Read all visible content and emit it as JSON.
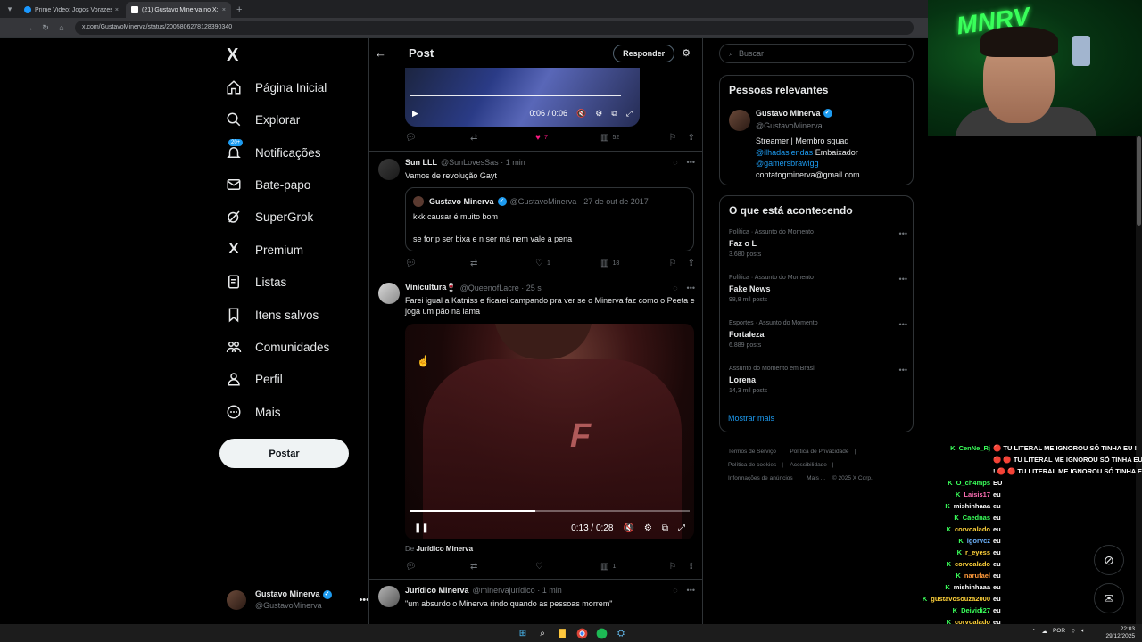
{
  "browser": {
    "tabs": [
      {
        "title": "Prime Video: Jogos Vorazes: A ...",
        "active": false,
        "favicon_color": "#1a98ff"
      },
      {
        "title": "(21) Gustavo Minerva no X: \"...",
        "active": true,
        "favicon_color": "#ffffff"
      }
    ],
    "new_tab": "+",
    "url": "x.com/GustavoMinerva/status/2005806278128390340"
  },
  "nav": {
    "logo": "X",
    "items": [
      {
        "label": "Página Inicial",
        "icon": "home-icon"
      },
      {
        "label": "Explorar",
        "icon": "search-icon"
      },
      {
        "label": "Notificações",
        "icon": "bell-icon",
        "badge": "20+"
      },
      {
        "label": "Bate-papo",
        "icon": "mail-icon"
      },
      {
        "label": "SuperGrok",
        "icon": "grok-icon"
      },
      {
        "label": "Premium",
        "icon": "x-icon"
      },
      {
        "label": "Listas",
        "icon": "list-icon"
      },
      {
        "label": "Itens salvos",
        "icon": "bookmark-icon"
      },
      {
        "label": "Comunidades",
        "icon": "communities-icon"
      },
      {
        "label": "Perfil",
        "icon": "person-icon"
      },
      {
        "label": "Mais",
        "icon": "more-circle-icon"
      }
    ],
    "post_button": "Postar",
    "account": {
      "name": "Gustavo Minerva",
      "handle": "@GustavoMinerva"
    }
  },
  "center": {
    "title": "Post",
    "reply_button": "Responder",
    "video1": {
      "time": "0:06 / 0:06",
      "progress": 1.0
    },
    "video1_actions": {
      "replies": "",
      "reposts": "",
      "likes": "7",
      "views": "52"
    },
    "tweets": [
      {
        "name": "Sun LLL",
        "handle": "@SunLovesSas",
        "time": "· 1 min",
        "text": "Vamos de revolução Gayt",
        "quote": {
          "name": "Gustavo Minerva",
          "handle": "@GustavoMinerva",
          "date": "· 27 de out de 2017",
          "line1": "kkk causar é muito bom",
          "line2": "se for p ser bixa e n ser má nem vale a pena"
        },
        "actions": {
          "replies": "",
          "reposts": "",
          "likes": "1",
          "views": "18"
        }
      },
      {
        "name": "Vinicultura🍷",
        "handle": "@QueenofLacre",
        "time": "· 25 s",
        "text": "Farei igual a Katniss e ficarei campando pra ver se o Minerva faz como o Peeta e joga um pão na lama",
        "video": {
          "time": "0:13 / 0:28",
          "progress": 0.45
        },
        "from_prefix": "De",
        "from_name": "Jurídico Minerva",
        "actions": {
          "replies": "",
          "reposts": "",
          "likes": "",
          "views": "1"
        }
      },
      {
        "name": "Jurídico Minerva",
        "handle": "@minervajurídico",
        "time": "· 1 min",
        "text": "\"um absurdo o Minerva rindo quando as pessoas morrem\""
      }
    ]
  },
  "right": {
    "search_placeholder": "Buscar",
    "relevant": {
      "title": "Pessoas relevantes",
      "name": "Gustavo Minerva",
      "handle": "@GustavoMinerva",
      "bio1": "Streamer | Membro squad",
      "bio_link1": "@ilhadaslendas",
      "bio2": " Embaixador",
      "bio_link2": "@gamersbrawlgg",
      "bio3": "contatogminerva@gmail.com"
    },
    "trends_title": "O que está acontecendo",
    "trends": [
      {
        "category": "Política · Assunto do Momento",
        "name": "Faz o L",
        "count": "3.680 posts"
      },
      {
        "category": "Política · Assunto do Momento",
        "name": "Fake News",
        "count": "98,8 mil posts"
      },
      {
        "category": "Esportes · Assunto do Momento",
        "name": "Fortaleza",
        "count": "6.889 posts"
      },
      {
        "category": "Assunto do Momento em Brasil",
        "name": "Lorena",
        "count": "14,3 mil posts"
      }
    ],
    "show_more": "Mostrar mais",
    "footer": [
      "Termos de Serviço",
      "|",
      "Política de Privacidade",
      "|",
      "Política de cookies",
      "|",
      "Acessibilidade",
      "|",
      "Informações de anúncios",
      "|",
      "Mais ...",
      "© 2025 X Corp."
    ]
  },
  "chat": [
    {
      "user": "CenNe_Rj",
      "color": "#3aff5a",
      "msg": "🔴 TU LITERAL ME IGNOROU SÓ TINHA EU !"
    },
    {
      "user": "",
      "color": "#ffffff",
      "msg": "🔴 🔴 TU LITERAL ME IGNOROU SÓ TINHA EU !"
    },
    {
      "user": "",
      "color": "#ffffff",
      "msg": "! 🔴 🔴 TU LITERAL ME IGNOROU SÓ TINHA EU ! 🔴"
    },
    {
      "user": "O_ch4mps",
      "color": "#3aff5a",
      "msg": "EU"
    },
    {
      "user": "Laisis17",
      "color": "#ff6fb5",
      "msg": "eu"
    },
    {
      "user": "mishinhaaa",
      "color": "#ffffff",
      "msg": "eu"
    },
    {
      "user": "Caednas",
      "color": "#3aff5a",
      "msg": "eu"
    },
    {
      "user": "corvoalado",
      "color": "#ffd23a",
      "msg": "eu"
    },
    {
      "user": "igorvcz",
      "color": "#6fb5ff",
      "msg": "eu"
    },
    {
      "user": "r_eyess",
      "color": "#ffd23a",
      "msg": "eu"
    },
    {
      "user": "corvoalado",
      "color": "#ffd23a",
      "msg": "eu"
    },
    {
      "user": "narufael",
      "color": "#ff9a3a",
      "msg": "eu"
    },
    {
      "user": "mishinhaaa",
      "color": "#ffffff",
      "msg": "eu"
    },
    {
      "user": "gustavosouza2000",
      "color": "#ffd23a",
      "msg": "eu"
    },
    {
      "user": "Deividi27",
      "color": "#3aff5a",
      "msg": "eu"
    },
    {
      "user": "corvoalado",
      "color": "#ffd23a",
      "msg": "eu"
    }
  ],
  "taskbar": {
    "lang": "POR",
    "time": "22:03",
    "date": "29/12/2025"
  },
  "colors": {
    "accent": "#1d9bf0",
    "like": "#f91880",
    "border": "#2f3336",
    "muted": "#71767b"
  }
}
